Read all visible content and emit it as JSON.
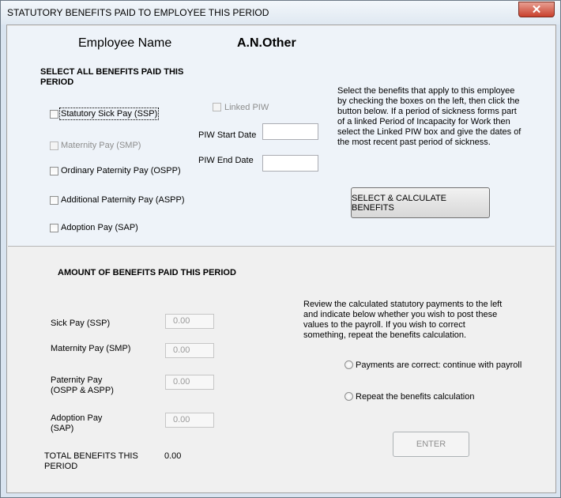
{
  "window": {
    "title": "STATUTORY BENEFITS PAID TO EMPLOYEE THIS PERIOD",
    "close_glyph": "✕"
  },
  "employee": {
    "label": "Employee Name",
    "name": "A.N.Other"
  },
  "select_section": {
    "heading_line1": "SELECT ALL BENEFITS PAID THIS",
    "heading_line2": "PERIOD",
    "benefits": {
      "ssp": "Statutory Sick Pay (SSP)",
      "smp": "Maternity Pay (SMP)",
      "ospp": "Ordinary Paternity Pay (OSPP)",
      "aspp": "Additional Paternity Pay (ASPP)",
      "sap": "Adoption Pay (SAP)"
    },
    "linked_piw": "Linked PIW",
    "piw_start_label": "PIW Start Date",
    "piw_start_value": "",
    "piw_end_label": "PIW End Date",
    "piw_end_value": "",
    "instructions": [
      "Select the benefits that apply to this employee",
      "by checking the boxes on the left, then click the",
      "button below.  If a period of sickness forms part",
      "of a linked Period of Incapacity for Work then",
      "select the Linked PIW box and give the dates of",
      "the most recent past period of sickness."
    ],
    "calculate_button": "SELECT & CALCULATE BENEFITS"
  },
  "amount_section": {
    "heading": "AMOUNT OF  BENEFITS PAID THIS PERIOD",
    "sick_pay_label": "Sick Pay (SSP)",
    "sick_pay_value": "0.00",
    "maternity_label": "Maternity Pay (SMP)",
    "maternity_value": "0.00",
    "paternity_label_line1": "Paternity Pay",
    "paternity_label_line2": "(OSPP & ASPP)",
    "paternity_value": "0.00",
    "adoption_label_line1": "Adoption Pay",
    "adoption_label_line2": "(SAP)",
    "adoption_value": "0.00",
    "total_label_line1": "TOTAL BENEFITS THIS",
    "total_label_line2": "PERIOD",
    "total_value": "0.00",
    "review_text": [
      "Review the calculated statutory payments to the left",
      "and indicate below whether you wish to post these",
      "values to the payroll.  If you wish to correct",
      "something, repeat the benefits calculation."
    ],
    "option_continue": "Payments are correct: continue with payroll",
    "option_repeat": "Repeat the benefits calculation",
    "enter_button": "ENTER"
  }
}
